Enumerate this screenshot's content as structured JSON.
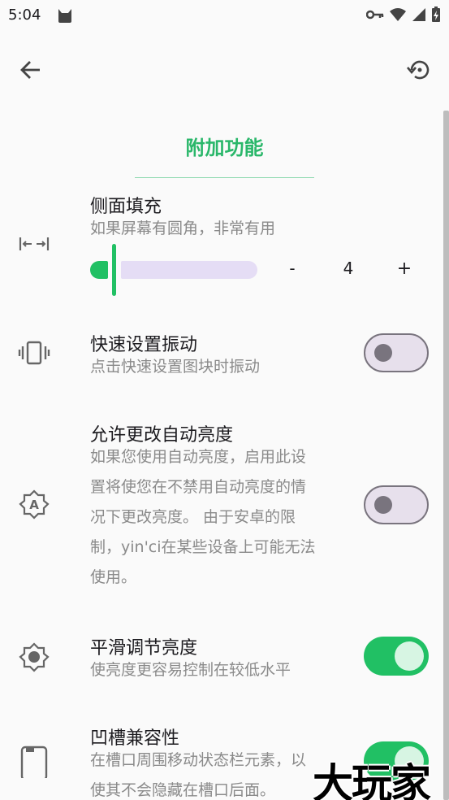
{
  "status_bar": {
    "time": "5:04"
  },
  "toolbar": {
    "back_icon": "arrow-left-icon",
    "history_icon": "restore-icon"
  },
  "section": {
    "title": "附加功能"
  },
  "settings": [
    {
      "title": "侧面填充",
      "summary": "如果屏幕有圆角，非常有用",
      "icon": "horizontal-padding-icon",
      "stepper": {
        "minus": "-",
        "value": "4",
        "plus": "+"
      },
      "slider_fraction": 0.08
    },
    {
      "title": "快速设置振动",
      "summary": "点击快速设置图块时振动",
      "icon": "vibration-icon",
      "enabled": false
    },
    {
      "title": "允许更改自动亮度",
      "summary_lines": [
        "如果您使用自动亮度，启用此设",
        "置将使您在不禁用自动亮度的情",
        "况下更改亮度。 由于安卓的限",
        "制，yin'ci在某些设备上可能无法",
        "使用。"
      ],
      "icon": "auto-brightness-icon",
      "enabled": false
    },
    {
      "title": "平滑调节亮度",
      "summary": "使亮度更容易控制在较低水平",
      "icon": "brightness-icon",
      "enabled": true
    },
    {
      "title": "凹槽兼容性",
      "summary_lines": [
        "在槽口周围移动状态栏元素，以",
        "使其不会隐藏在槽口后面。"
      ],
      "icon": "notch-phone-icon",
      "enabled": true
    }
  ],
  "watermark": "大玩家",
  "colors": {
    "accent": "#21C064",
    "title_green": "#2AB76A"
  }
}
